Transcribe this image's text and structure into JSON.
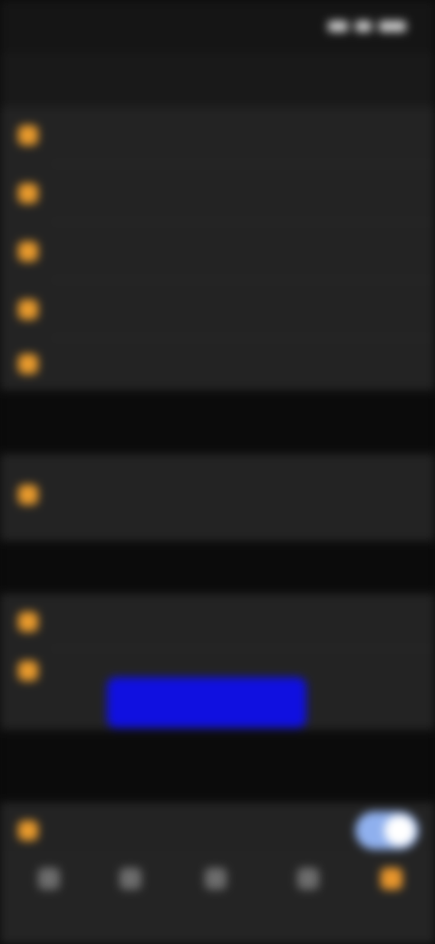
{
  "status_bar": {
    "time": "",
    "icons": [
      "signal-icon",
      "wifi-icon",
      "battery-icon"
    ]
  },
  "header": {
    "back_label": "",
    "title": ""
  },
  "sections": [
    {
      "rows": [
        {
          "icon": "settings-icon",
          "label": "",
          "value": ""
        },
        {
          "icon": "settings-icon",
          "label": "",
          "value": ""
        },
        {
          "icon": "settings-icon",
          "label": "",
          "value": ""
        },
        {
          "icon": "settings-icon",
          "label": "",
          "value": ""
        },
        {
          "icon": "settings-icon",
          "label": "",
          "sub": "",
          "value": ""
        }
      ]
    },
    {
      "rows": [
        {
          "icon": "settings-icon",
          "label": "",
          "value": ""
        }
      ]
    },
    {
      "rows": [
        {
          "icon": "settings-icon",
          "label": "",
          "value": ""
        },
        {
          "icon": "settings-icon",
          "label": ""
        }
      ],
      "button_label": ""
    },
    {
      "rows": [
        {
          "icon": "settings-icon",
          "label": "",
          "toggle_on": true
        }
      ]
    }
  ],
  "tab_bar": {
    "active_index": 4,
    "tabs": [
      {
        "icon": "tab-icon",
        "label": ""
      },
      {
        "icon": "tab-icon",
        "label": ""
      },
      {
        "icon": "tab-icon",
        "label": ""
      },
      {
        "icon": "tab-icon",
        "label": ""
      },
      {
        "icon": "tab-icon",
        "label": ""
      }
    ]
  },
  "colors": {
    "accent": "#e8962c",
    "button": "#1010e0",
    "toggle_on": "#8fb0ee",
    "background": "#0b0b0b",
    "surface": "#232323"
  }
}
